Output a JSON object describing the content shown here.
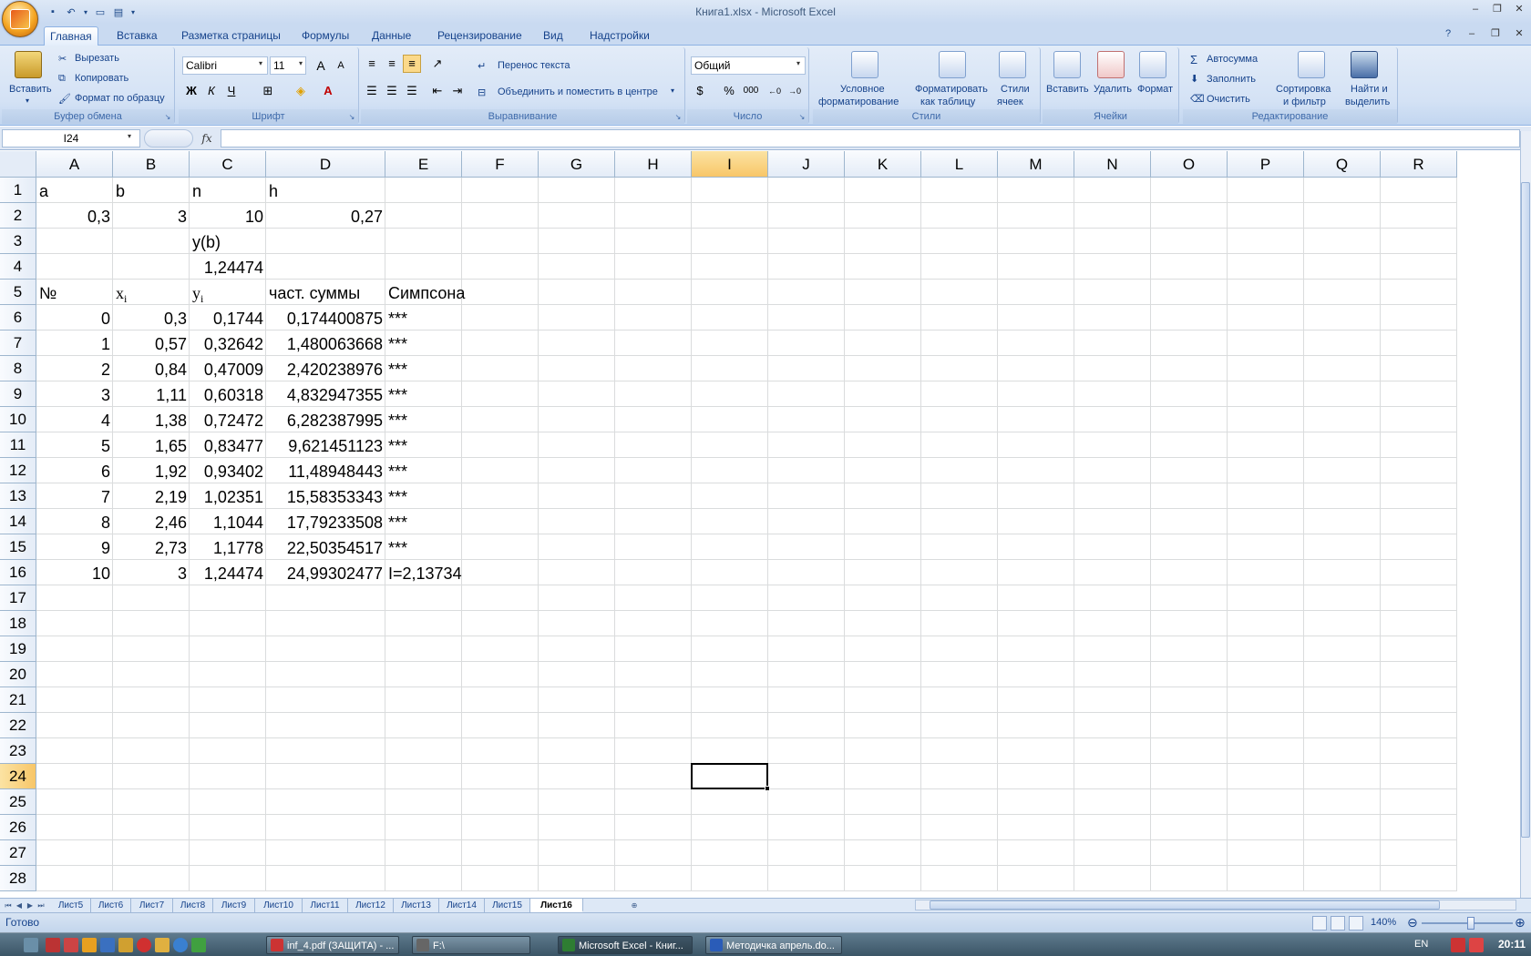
{
  "window": {
    "title": "Книга1.xlsx - Microsoft Excel"
  },
  "tabs": [
    "Главная",
    "Вставка",
    "Разметка страницы",
    "Формулы",
    "Данные",
    "Рецензирование",
    "Вид",
    "Надстройки"
  ],
  "ribbon": {
    "clipboard": {
      "label": "Буфер обмена",
      "paste": "Вставить",
      "cut": "Вырезать",
      "copy": "Копировать",
      "format_painter": "Формат по образцу"
    },
    "font": {
      "label": "Шрифт",
      "name": "Calibri",
      "size": "11",
      "bold": "Ж",
      "italic": "К",
      "underline": "Ч",
      "font_color_glyph": "A",
      "grow_glyph": "A",
      "shrink_glyph": "A"
    },
    "alignment": {
      "label": "Выравнивание",
      "wrap": "Перенос текста",
      "merge": "Объединить и поместить в центре"
    },
    "number": {
      "label": "Число",
      "format": "Общий",
      "percent": "%",
      "thousands": "000"
    },
    "styles": {
      "label": "Стили",
      "conditional_line1": "Условное",
      "conditional_line2": "форматирование",
      "table_line1": "Форматировать",
      "table_line2": "как таблицу",
      "cell_styles_line1": "Стили",
      "cell_styles_line2": "ячеек"
    },
    "cells": {
      "label": "Ячейки",
      "insert": "Вставить",
      "delete": "Удалить",
      "format": "Формат"
    },
    "editing": {
      "label": "Редактирование",
      "autosum": "Автосумма",
      "fill": "Заполнить",
      "clear": "Очистить",
      "sort_line1": "Сортировка",
      "sort_line2": "и фильтр",
      "find_line1": "Найти и",
      "find_line2": "выделить"
    }
  },
  "formula_bar": {
    "name_box": "I24",
    "fx": "fx",
    "formula": ""
  },
  "columns": [
    "A",
    "B",
    "C",
    "D",
    "E",
    "F",
    "G",
    "H",
    "I",
    "J",
    "K",
    "L",
    "M",
    "N",
    "O",
    "P",
    "Q",
    "R"
  ],
  "rows": [
    "1",
    "2",
    "3",
    "4",
    "5",
    "6",
    "7",
    "8",
    "9",
    "10",
    "11",
    "12",
    "13",
    "14",
    "15",
    "16",
    "17",
    "18",
    "19",
    "20",
    "21",
    "22",
    "23",
    "24",
    "25",
    "26",
    "27",
    "28"
  ],
  "cells": {
    "A1": "a",
    "B1": "b",
    "C1": "n",
    "D1": "h",
    "A2": "0,3",
    "B2": "3",
    "C2": "10",
    "D2": "0,27",
    "C3": "y(b)",
    "C4": "1,24474",
    "A5": "№",
    "B5_base": "x",
    "B5_sub": "i",
    "C5_base": "y",
    "C5_sub": "i",
    "D5": "част. суммы",
    "E5": "Симпсона",
    "A6": "0",
    "B6": "0,3",
    "C6": "0,1744",
    "D6": "0,174400875",
    "E6": "***",
    "A7": "1",
    "B7": "0,57",
    "C7": "0,32642",
    "D7": "1,480063668",
    "E7": "***",
    "A8": "2",
    "B8": "0,84",
    "C8": "0,47009",
    "D8": "2,420238976",
    "E8": "***",
    "A9": "3",
    "B9": "1,11",
    "C9": "0,60318",
    "D9": "4,832947355",
    "E9": "***",
    "A10": "4",
    "B10": "1,38",
    "C10": "0,72472",
    "D10": "6,282387995",
    "E10": "***",
    "A11": "5",
    "B11": "1,65",
    "C11": "0,83477",
    "D11": "9,621451123",
    "E11": "***",
    "A12": "6",
    "B12": "1,92",
    "C12": "0,93402",
    "D12": "11,48948443",
    "E12": "***",
    "A13": "7",
    "B13": "2,19",
    "C13": "1,02351",
    "D13": "15,58353343",
    "E13": "***",
    "A14": "8",
    "B14": "2,46",
    "C14": "1,1044",
    "D14": "17,79233508",
    "E14": "***",
    "A15": "9",
    "B15": "2,73",
    "C15": "1,1778",
    "D15": "22,50354517",
    "E15": "***",
    "A16": "10",
    "B16": "3",
    "C16": "1,24474",
    "D16": "24,99302477",
    "E16": "I=2,13734"
  },
  "sheets": [
    "Лист5",
    "Лист6",
    "Лист7",
    "Лист8",
    "Лист9",
    "Лист10",
    "Лист11",
    "Лист12",
    "Лист13",
    "Лист14",
    "Лист15",
    "Лист16"
  ],
  "active_sheet": "Лист16",
  "status": {
    "ready": "Готово",
    "zoom": "140%"
  },
  "taskbar": {
    "tasks": [
      "inf_4.pdf (ЗАЩИТА) - ...",
      "F:\\",
      "Microsoft Excel - Книг...",
      "Методичка апрель.do..."
    ],
    "lang": "EN",
    "clock": "20:11"
  },
  "colors": {
    "accent": "#15428b",
    "ribbon": "#d4e2f5",
    "selected_header": "#f8c668"
  }
}
